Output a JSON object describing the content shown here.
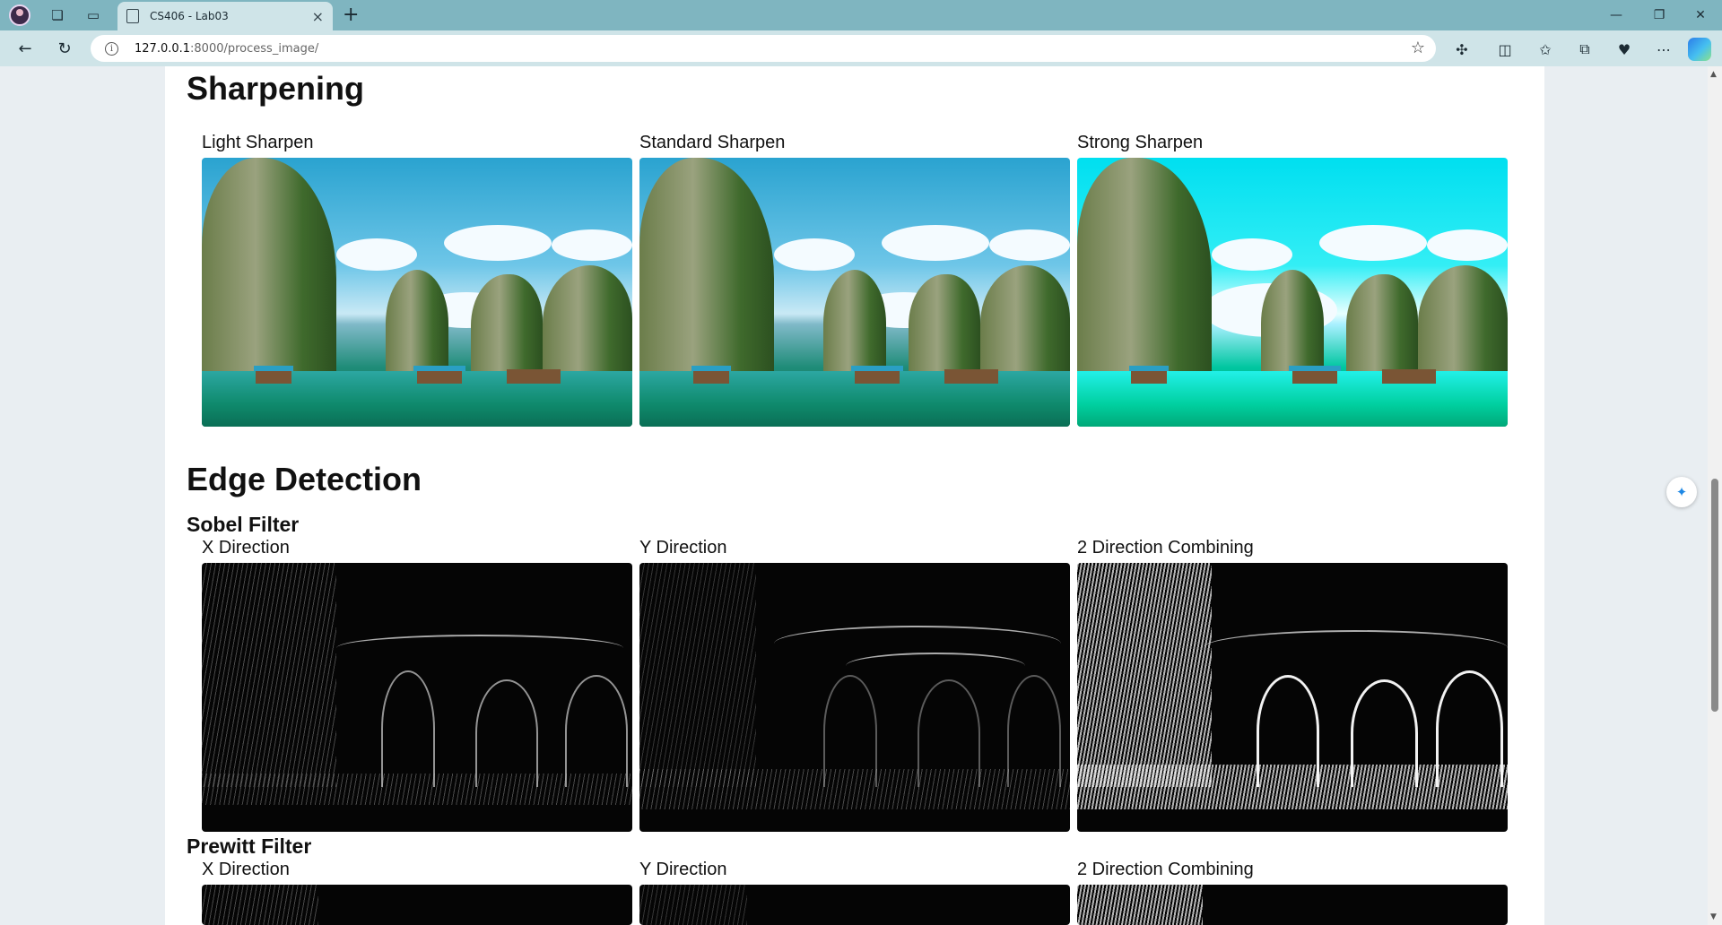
{
  "browser": {
    "tab_title": "CS406 - Lab03",
    "tab_close": "×",
    "new_tab": "+",
    "url_host": "127.0.0.1",
    "url_path": ":8000/process_image/",
    "window_controls": {
      "minimize": "—",
      "restore": "❐",
      "close": "✕"
    }
  },
  "sections": {
    "sharpening": {
      "title": "Sharpening",
      "captions": [
        "Light Sharpen",
        "Standard Sharpen",
        "Strong Sharpen"
      ]
    },
    "edge_detection": {
      "title": "Edge Detection",
      "sobel": {
        "title": "Sobel Filter",
        "captions": [
          "X Direction",
          "Y Direction",
          "2 Direction Combining"
        ]
      },
      "prewitt": {
        "title": "Prewitt Filter",
        "captions": [
          "X Direction",
          "Y Direction",
          "2 Direction Combining"
        ]
      }
    }
  },
  "icons": {
    "profile": "profile-avatar",
    "workspaces": "workspaces-icon",
    "tab_actions": "tab-actions-icon",
    "back": "back-arrow-icon",
    "refresh": "refresh-icon",
    "info": "site-info-icon",
    "favorite": "star-icon",
    "extensions": "extensions-icon",
    "split_screen": "split-screen-icon",
    "favorites": "favorites-icon",
    "collections": "collections-icon",
    "performance": "performance-icon",
    "more": "more-icon",
    "copilot": "copilot-icon"
  },
  "colors": {
    "titlebar": "#7fb5c0",
    "toolbar": "#cfe4e8",
    "page_background": "#e9eef2"
  }
}
